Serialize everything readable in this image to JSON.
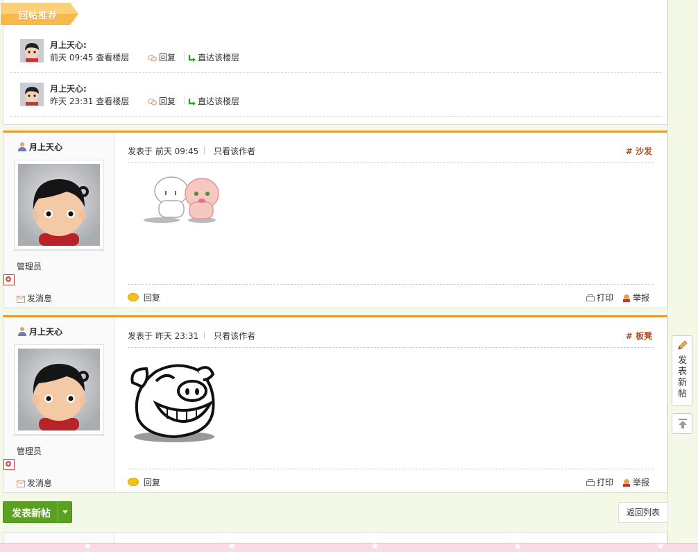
{
  "recommend": {
    "title": "回帖推荐",
    "items": [
      {
        "user": "月上天心:",
        "time": "前天 09:45 查看楼层",
        "reply": "回复",
        "goto": "直达该楼层"
      },
      {
        "user": "月上天心:",
        "time": "昨天 23:31 查看楼层",
        "reply": "回复",
        "goto": "直达该楼层"
      }
    ]
  },
  "posts": [
    {
      "user": "月上天心",
      "role": "管理员",
      "send_msg": "发消息",
      "posted": "发表于 前天 09:45",
      "only_author": "只看该作者",
      "floor": "# 沙发",
      "reply": "回复",
      "print": "打印",
      "report": "举报"
    },
    {
      "user": "月上天心",
      "role": "管理员",
      "send_msg": "发消息",
      "posted": "发表于 昨天 23:31",
      "only_author": "只看该作者",
      "floor": "# 板凳",
      "reply": "回复",
      "print": "打印",
      "report": "举报"
    }
  ],
  "buttons": {
    "new_thread": "发表新帖",
    "back": "返回列表"
  },
  "side_tools": {
    "post": "发表新帖"
  },
  "colors": {
    "accent_orange": "#e69a2f",
    "button_green": "#5aa121",
    "floor_text": "#b8521f",
    "page_bg": "#f3f9e6"
  },
  "icons": [
    "avatar",
    "reply-icon",
    "goto-floor-icon",
    "user-icon",
    "mail-icon",
    "chat-bubble-icon",
    "print-icon",
    "report-icon",
    "pencil-icon",
    "back-to-top-icon",
    "badge-icon"
  ]
}
